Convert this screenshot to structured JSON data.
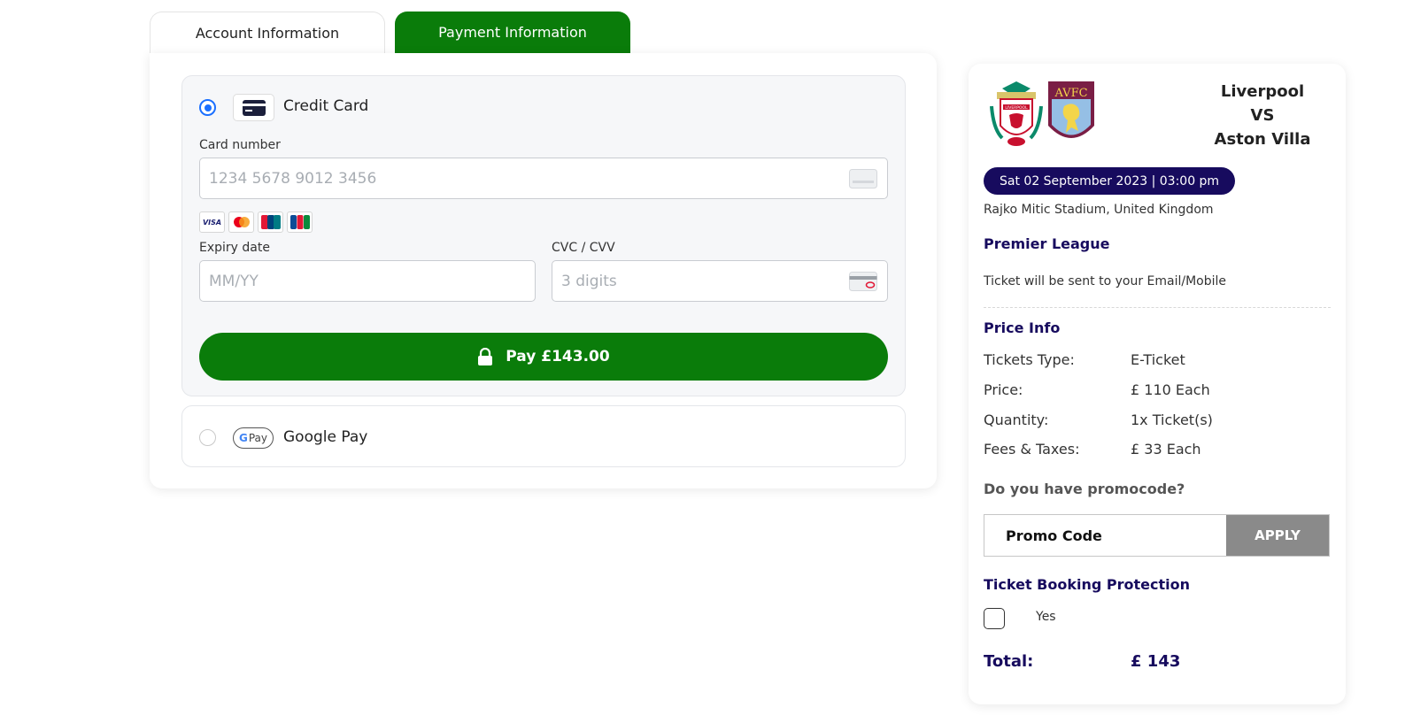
{
  "tabs": {
    "account": "Account Information",
    "payment": "Payment Information"
  },
  "credit_card": {
    "title": "Credit Card",
    "card_number_label": "Card number",
    "card_number_placeholder": "1234 5678 9012 3456",
    "brands": [
      "VISA",
      "Mastercard",
      "UnionPay",
      "JCB"
    ],
    "expiry_label": "Expiry date",
    "expiry_placeholder": "MM/YY",
    "cvc_label": "CVC / CVV",
    "cvc_placeholder": "3 digits",
    "pay_button": "Pay £143.00"
  },
  "google_pay": {
    "icon_text_g": "G",
    "icon_text_pay": "Pay",
    "title": "Google Pay"
  },
  "summary": {
    "crest_liverpool": "LIVERPOOL",
    "crest_villa": "AVFC",
    "team_home": "Liverpool",
    "vs": "VS",
    "team_away": "Aston Villa",
    "date": "Sat 02 September 2023 | 03:00 pm",
    "venue": "Rajko Mitic Stadium, United Kingdom",
    "league": "Premier League",
    "ticket_note": "Ticket will be sent to your Email/Mobile",
    "price_info_title": "Price Info",
    "price_rows": [
      {
        "label": "Tickets Type:",
        "value": "E-Ticket"
      },
      {
        "label": "Price:",
        "value": "£ 110 Each"
      },
      {
        "label": "Quantity:",
        "value": "1x Ticket(s)"
      },
      {
        "label": "Fees & Taxes:",
        "value": "£ 33 Each"
      }
    ],
    "promo_question": "Do you have promocode?",
    "promo_placeholder": "Promo Code",
    "apply_label": "APPLY",
    "protection_title": "Ticket Booking Protection",
    "protection_option": "Yes",
    "total_label": "Total:",
    "total_value": "£ 143"
  },
  "colors": {
    "accent_green": "#0a7c0a",
    "navy": "#170b5e",
    "radio_blue": "#1a6fff"
  }
}
